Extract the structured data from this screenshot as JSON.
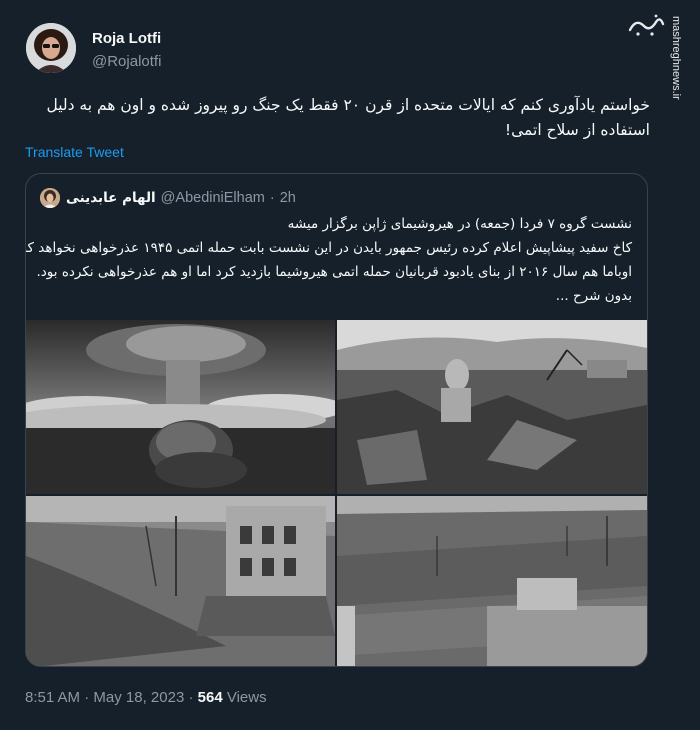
{
  "author": {
    "name": "Roja Lotfi",
    "handle": "@Rojalotfi"
  },
  "watermark": {
    "logo_text": "مشرق",
    "side_text": "mashreghnews.ir"
  },
  "tweet": {
    "text": "خواستم یادآوری کنم که ایالات متحده از قرن ۲۰ فقط یک جنگ رو پیروز شده و اون هم به دلیل استفاده از سلاح اتمی!",
    "translate_label": "Translate Tweet"
  },
  "quote": {
    "name": "الهام عابدینی",
    "handle": "@AbediniElham",
    "dot": "·",
    "time": "2h",
    "lines": [
      "نشست گروه ۷ فردا (جمعه) در هیروشیمای ژاپن برگزار میشه",
      "کاخ سفید پیشاپیش اعلام کرده رئیس جمهور بایدن در این نشست بابت حمله اتمی ۱۹۴۵ عذرخواهی نخواهد کرد.",
      "اوباما هم سال ۲۰۱۶ از بنای یادبود قربانیان حمله اتمی هیروشیما بازدید کرد اما او هم عذرخواهی نکرده بود.",
      "بدون شرح ..."
    ]
  },
  "footer": {
    "time": "8:51 AM",
    "dot": "·",
    "date": "May 18, 2023",
    "dot2": "·",
    "views_count": "564",
    "views_label": "Views"
  },
  "colors": {
    "background": "#15202b",
    "link": "#1d9bf0",
    "secondary_text": "#8b98a5",
    "border": "#38444d"
  }
}
